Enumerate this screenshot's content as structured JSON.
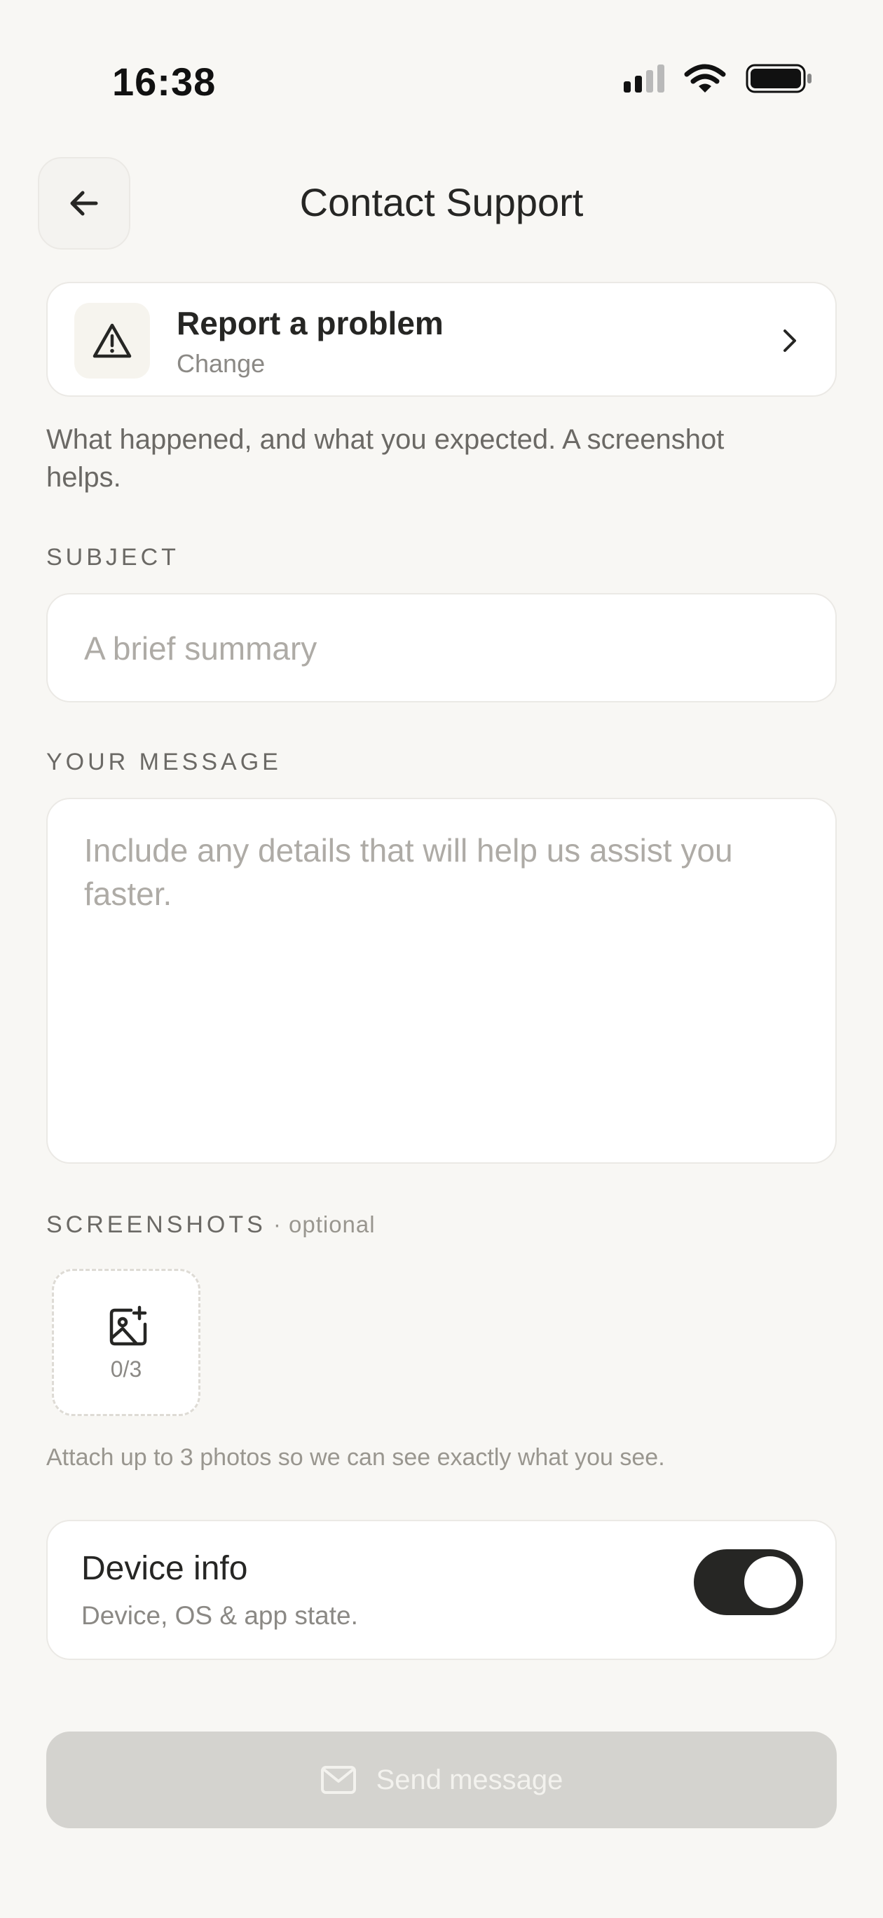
{
  "status_bar": {
    "time": "16:38"
  },
  "header": {
    "title": "Contact Support",
    "back_icon": "arrow-left-icon"
  },
  "category": {
    "title": "Report a problem",
    "change_label": "Change",
    "icon": "warning-triangle-icon"
  },
  "description": "What happened, and what you expected. A screenshot helps.",
  "subject": {
    "label": "SUBJECT",
    "placeholder": "A brief summary"
  },
  "message": {
    "label": "YOUR MESSAGE",
    "placeholder": "Include any details that will help us assist you faster."
  },
  "screenshots": {
    "label": "SCREENSHOTS",
    "optional": "· optional",
    "count": "0/3",
    "hint": "Attach up to 3 photos so we can see exactly what you see."
  },
  "device_info": {
    "title": "Device info",
    "subtitle": "Device, OS & app state.",
    "enabled": true
  },
  "send_button": {
    "label": "Send message",
    "icon": "mail-icon"
  },
  "colors": {
    "background": "#f8f7f4",
    "toggle_on": "#262624",
    "button_disabled": "#d4d3cf"
  }
}
